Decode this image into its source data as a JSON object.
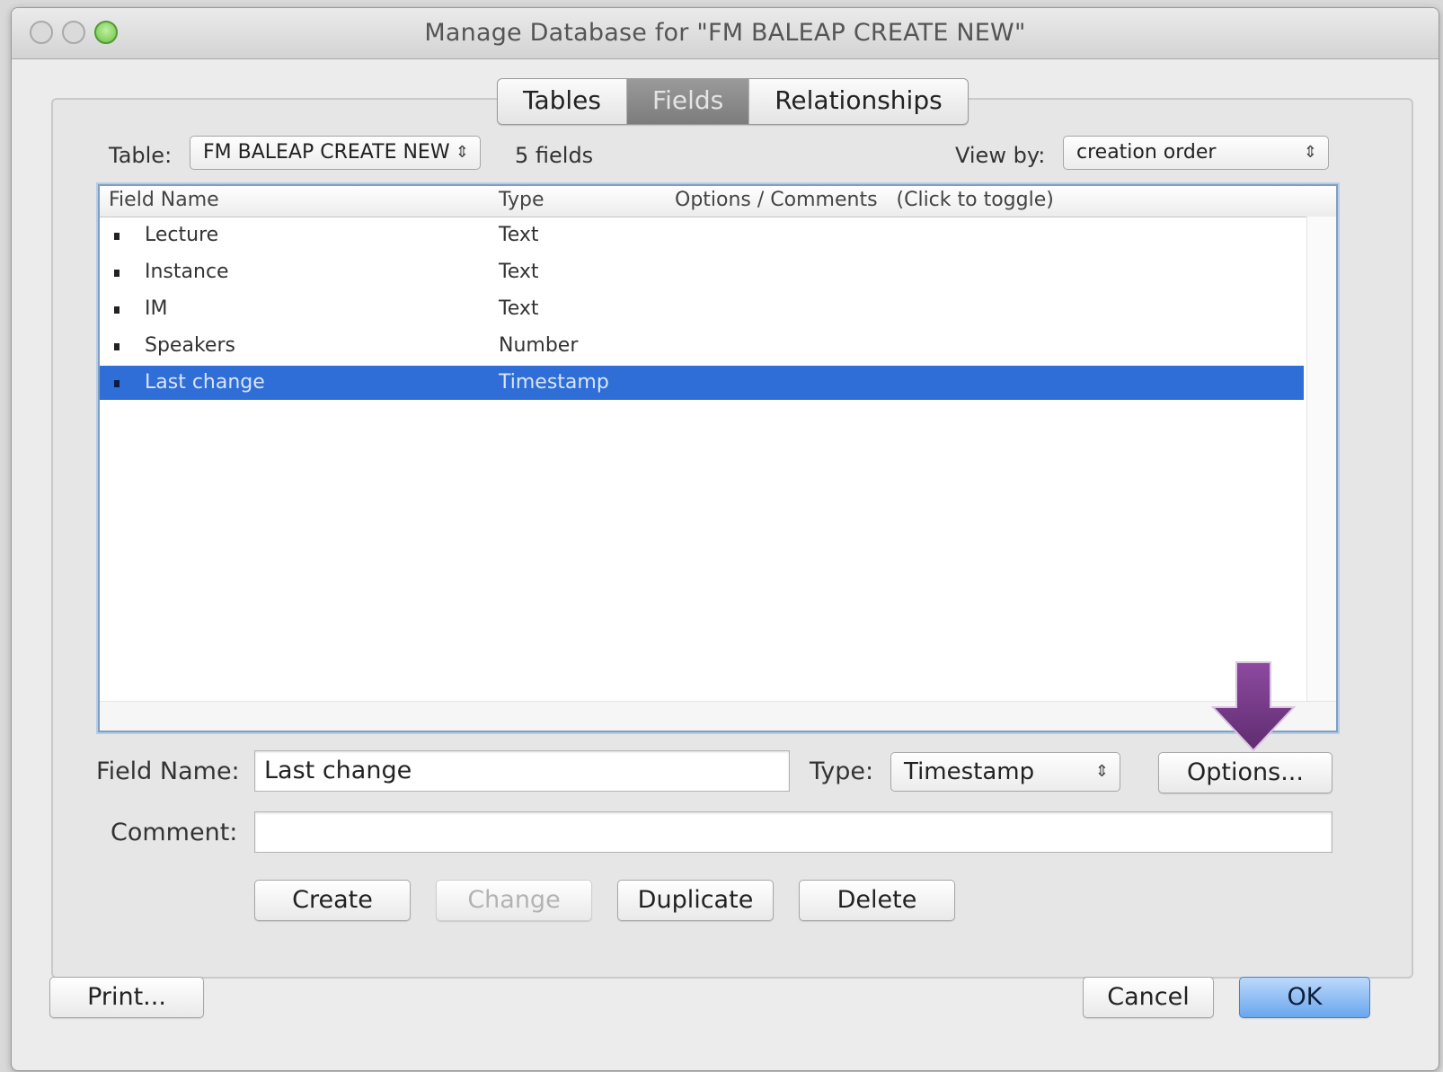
{
  "window": {
    "title": "Manage Database for \"FM BALEAP CREATE NEW\""
  },
  "tabs": [
    {
      "label": "Tables",
      "active": false
    },
    {
      "label": "Fields",
      "active": true
    },
    {
      "label": "Relationships",
      "active": false
    }
  ],
  "table_selector": {
    "label": "Table:",
    "value": "FM BALEAP CREATE NEW",
    "field_count": "5 fields"
  },
  "view_by": {
    "label": "View by:",
    "value": "creation order"
  },
  "field_list": {
    "headers": {
      "name": "Field Name",
      "type": "Type",
      "options": "Options / Comments   (Click to toggle)"
    },
    "rows": [
      {
        "name": "Lecture",
        "type": "Text",
        "selected": false
      },
      {
        "name": "Instance",
        "type": "Text",
        "selected": false
      },
      {
        "name": "IM",
        "type": "Text",
        "selected": false
      },
      {
        "name": "Speakers",
        "type": "Number",
        "selected": false
      },
      {
        "name": "Last change",
        "type": "Timestamp",
        "selected": true
      }
    ]
  },
  "editor": {
    "field_name_label": "Field Name:",
    "field_name_value": "Last change",
    "type_label": "Type:",
    "type_value": "Timestamp",
    "options_button": "Options...",
    "comment_label": "Comment:",
    "comment_value": ""
  },
  "actions": {
    "create": "Create",
    "change": "Change",
    "duplicate": "Duplicate",
    "delete": "Delete"
  },
  "footer": {
    "print": "Print...",
    "cancel": "Cancel",
    "ok": "OK"
  },
  "colors": {
    "selection": "#2f6ed6",
    "annotation_arrow": "#7b3f8e",
    "default_button": "#6aa6ee"
  },
  "icons": {
    "stepper": "up-down-arrows-icon",
    "annotation": "down-arrow-icon"
  }
}
